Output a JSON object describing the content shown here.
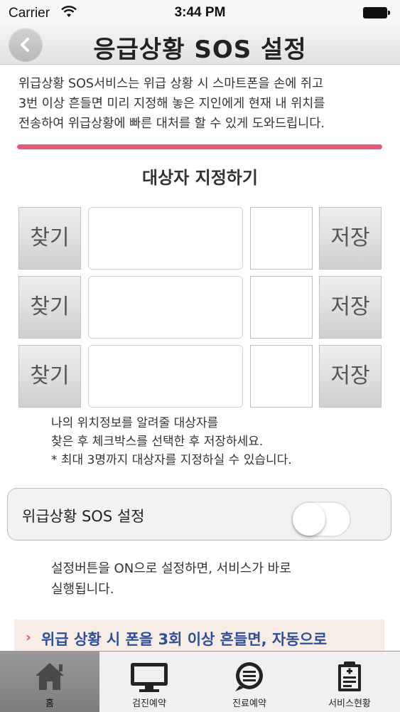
{
  "status_bar": {
    "carrier": "Carrier",
    "time": "3:44 PM"
  },
  "header": {
    "title": "응급상황 SOS 설정",
    "back_icon": "chevron-left-icon"
  },
  "intro": {
    "line1": "위급상황 SOS서비스는 위급 상황 시 스마트폰을 손에 쥐고",
    "line2": "3번 이상  흔들면 미리 지정해 놓은 지인에게 현재 내 위치를",
    "line3": "전송하여 위급상황에 빠른 대처를 할 수 있게 도와드립니다."
  },
  "targets": {
    "title": "대상자 지정하기",
    "rows": [
      {
        "find_label": "찾기",
        "name_value": "",
        "checked": false,
        "save_label": "저장"
      },
      {
        "find_label": "찾기",
        "name_value": "",
        "checked": false,
        "save_label": "저장"
      },
      {
        "find_label": "찾기",
        "name_value": "",
        "checked": false,
        "save_label": "저장"
      }
    ],
    "guide_line1": "나의 위치정보를 알려줄 대상자를",
    "guide_line2": "찾은 후 체크박스를 선택한 후 저장하세요.",
    "guide_line3": "* 최대 3명까지 대상자를 지정하실 수 있습니다."
  },
  "sos_setting": {
    "label": "위급상황 SOS 설정",
    "enabled": false,
    "desc_line1": "설정버튼을  ON으로 설정하면, 서비스가 바로",
    "desc_line2": "실행됩니다."
  },
  "notice": {
    "chevron": "›",
    "text": "위급 상황 시 폰을 3회 이상 흔들면, 자동으로"
  },
  "tab_bar": {
    "items": [
      {
        "label": "홈",
        "icon": "home-icon",
        "active": true
      },
      {
        "label": "검진예약",
        "icon": "monitor-icon",
        "active": false
      },
      {
        "label": "진료예약",
        "icon": "chat-bubble-icon",
        "active": false
      },
      {
        "label": "서비스현황",
        "icon": "clipboard-icon",
        "active": false
      }
    ]
  },
  "colors": {
    "accent_pink": "#e35b78",
    "notice_text": "#2d4f9a",
    "notice_bg": "#f8ece6"
  }
}
